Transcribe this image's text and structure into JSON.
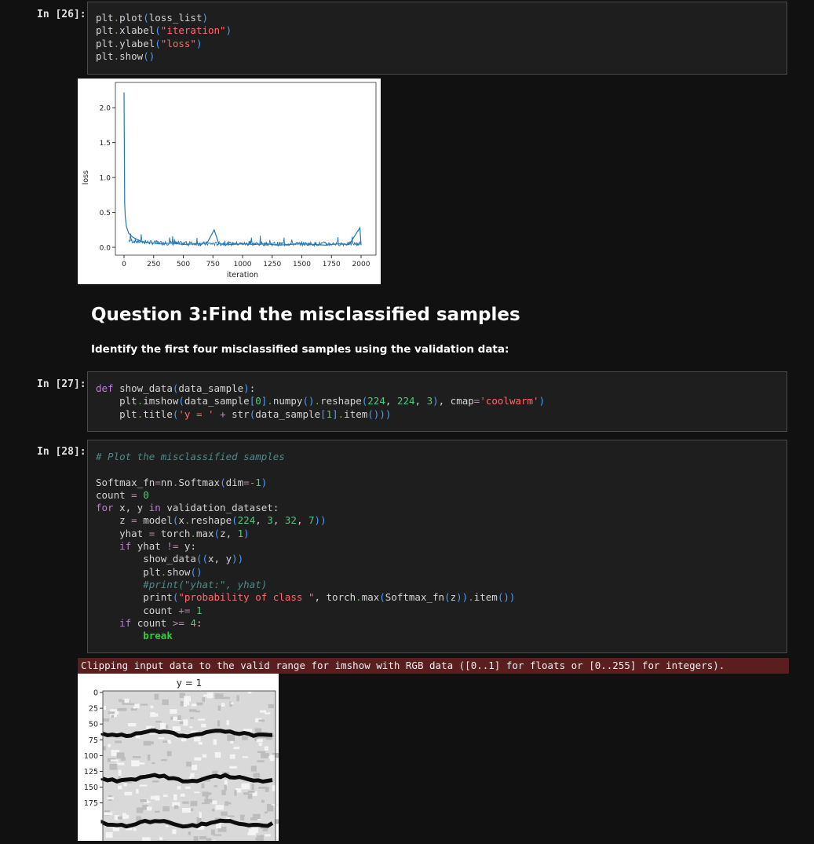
{
  "cells": [
    {
      "prompt": "In [26]:"
    },
    {
      "prompt": "In [27]:"
    },
    {
      "prompt": "In [28]:"
    }
  ],
  "markdown": {
    "heading": "Question 3:Find the misclassified samples",
    "subtext": "Identify the first four misclassified samples using the validation data:"
  },
  "warning": "Clipping input data to the valid range for imshow with RGB data ([0..1] for floats or [0..255] for integers).",
  "chart_data": [
    {
      "type": "line",
      "title": "",
      "xlabel": "iteration",
      "ylabel": "loss",
      "xlim": [
        0,
        2000
      ],
      "ylim": [
        0,
        2.25
      ],
      "xticks": [
        "0",
        "250",
        "500",
        "750",
        "1000",
        "1250",
        "1500",
        "1750",
        "2000"
      ],
      "yticks": [
        "0.0",
        "0.5",
        "1.0",
        "1.5",
        "2.0"
      ],
      "grid": false,
      "series": [
        {
          "color": "#1f77b4",
          "x": [
            0,
            5,
            10,
            20,
            40,
            70,
            100,
            150,
            200,
            300,
            400,
            500,
            600,
            700,
            760,
            800,
            900,
            1000,
            1100,
            1200,
            1300,
            1400,
            1500,
            1600,
            1700,
            1800,
            1900,
            1990,
            2000
          ],
          "values": [
            2.22,
            0.65,
            0.45,
            0.3,
            0.2,
            0.15,
            0.12,
            0.08,
            0.07,
            0.05,
            0.06,
            0.04,
            0.05,
            0.06,
            0.25,
            0.05,
            0.04,
            0.05,
            0.04,
            0.05,
            0.03,
            0.04,
            0.05,
            0.04,
            0.03,
            0.05,
            0.04,
            0.28,
            0.03
          ]
        }
      ]
    },
    {
      "type": "image",
      "title": "y = 1",
      "yticks": [
        "0",
        "25",
        "50",
        "75",
        "100",
        "125",
        "150",
        "175"
      ]
    }
  ]
}
